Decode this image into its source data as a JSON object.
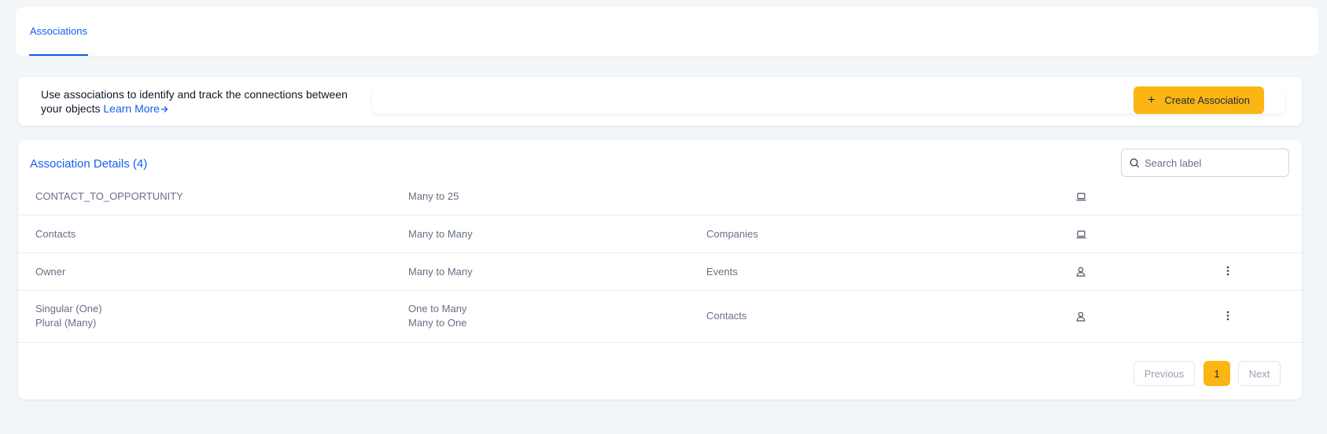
{
  "tabs": [
    {
      "label": "Associations",
      "active": true
    }
  ],
  "info": {
    "text_line1": "Use associations to identify and track the connections between",
    "text_line2": "your objects",
    "learn_more": "Learn More",
    "create_button": "Create Association"
  },
  "details": {
    "title": "Association Details (4)",
    "search_placeholder": "Search label",
    "rows": [
      {
        "label1": "CONTACT_TO_OPPORTUNITY",
        "label2": "",
        "rel1": "Many to 25",
        "rel2": "",
        "object": "",
        "icon": "laptop-icon",
        "menu": false
      },
      {
        "label1": "Contacts",
        "label2": "",
        "rel1": "Many to Many",
        "rel2": "",
        "object": "Companies",
        "icon": "laptop-icon",
        "menu": false
      },
      {
        "label1": "Owner",
        "label2": "",
        "rel1": "Many to Many",
        "rel2": "",
        "object": "Events",
        "icon": "user-icon",
        "menu": true
      },
      {
        "label1": "Singular (One)",
        "label2": "Plural (Many)",
        "rel1": "One to Many",
        "rel2": "Many to One",
        "object": "Contacts",
        "icon": "user-icon",
        "menu": true
      }
    ]
  },
  "pagination": {
    "previous": "Previous",
    "current": "1",
    "next": "Next"
  },
  "colors": {
    "accent": "#155eef",
    "button": "#fbb614",
    "background": "#f2f6f9"
  }
}
